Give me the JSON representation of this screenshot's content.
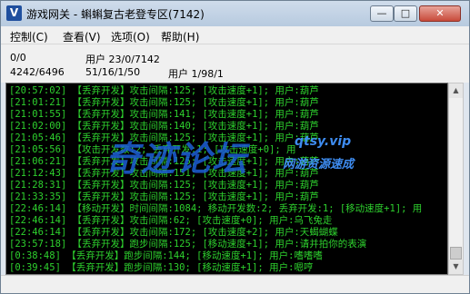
{
  "window": {
    "icon_letter": "V",
    "title": "游戏网关 - 蝌蝌复古老登专区(7142)",
    "controls": {
      "minimize": "—",
      "maximize": "□",
      "close": "✕"
    }
  },
  "menu": {
    "items": [
      "控制(C)",
      "查看(V)",
      "选项(O)",
      "帮助(H)"
    ]
  },
  "info": {
    "row1_col1": "0/0",
    "row1_col2": "用户 23/0/7142",
    "row2_col1": "4242/6496",
    "row2_col2": "51/16/1/50",
    "row2_col3": "用户 1/98/1"
  },
  "console": {
    "lines": [
      "[20:57:02] 【丢弃开发】攻击间隔:125; [攻击速度+1]; 用户:葫芦",
      "[21:01:21] 【丢弃开发】攻击间隔:125; [攻击速度+1]; 用户:葫芦",
      "[21:01:55] 【丢弃开发】攻击间隔:141; [攻击速度+1]; 用户:葫芦",
      "[21:02:00] 【丢弃开发】攻击间隔:140; [攻击速度+1]; 用户:葫芦",
      "[21:05:46] 【丢弃开发】攻击间隔:125; [攻击速度+1]; 用户:葫芦",
      "[21:05:56] 【攻击开发数:2; 丢弃开发:1; [攻击速度+0]; 用",
      "[21:06:21] 【丢弃开发】攻击间隔:125; [攻击速度+1]; 用户:葫芦",
      "[21:12:43] 【丢弃开发】攻击间隔:151; [攻击速度+1]; 用户:葫芦",
      "[21:28:31] 【丢弃开发】攻击间隔:125; [攻击速度+1]; 用户:葫芦",
      "[21:33:35] 【丢弃开发】攻击间隔:125; [攻击速度+1]; 用户:葫芦",
      "[22:46:14] 【移动开发】时间间隔:1084; 移动开发数:2; 丢弃开发:1; [移动速度+1]; 用",
      "[22:46:14] 【丢弃开发】攻击间隔:62; [攻击速度+0]; 用户:乌飞兔走",
      "[22:46:14] 【丢弃开发】攻击间隔:172; [攻击速度+2]; 用户:天蝎蝴蝶",
      "[23:57:18] 【丢弃开发】跑步间隔:125; [移动速度+1]; 用户:请并拍你的表演",
      "[0:38:48] 【丢弃开发】跑步间隔:144; [移动速度+1]; 用户:嗜嗜嗜",
      "[0:39:45] 【丢弃开发】跑步间隔:130; [移动速度+1]; 用户:嗯哼"
    ]
  },
  "watermark": {
    "main": "奇迹论坛",
    "url": "qtsy.vip",
    "sub": "网游资源速成"
  },
  "colors": {
    "console_bg": "#000000",
    "console_text": "#2ed12e",
    "watermark": "#1d5fd6"
  }
}
